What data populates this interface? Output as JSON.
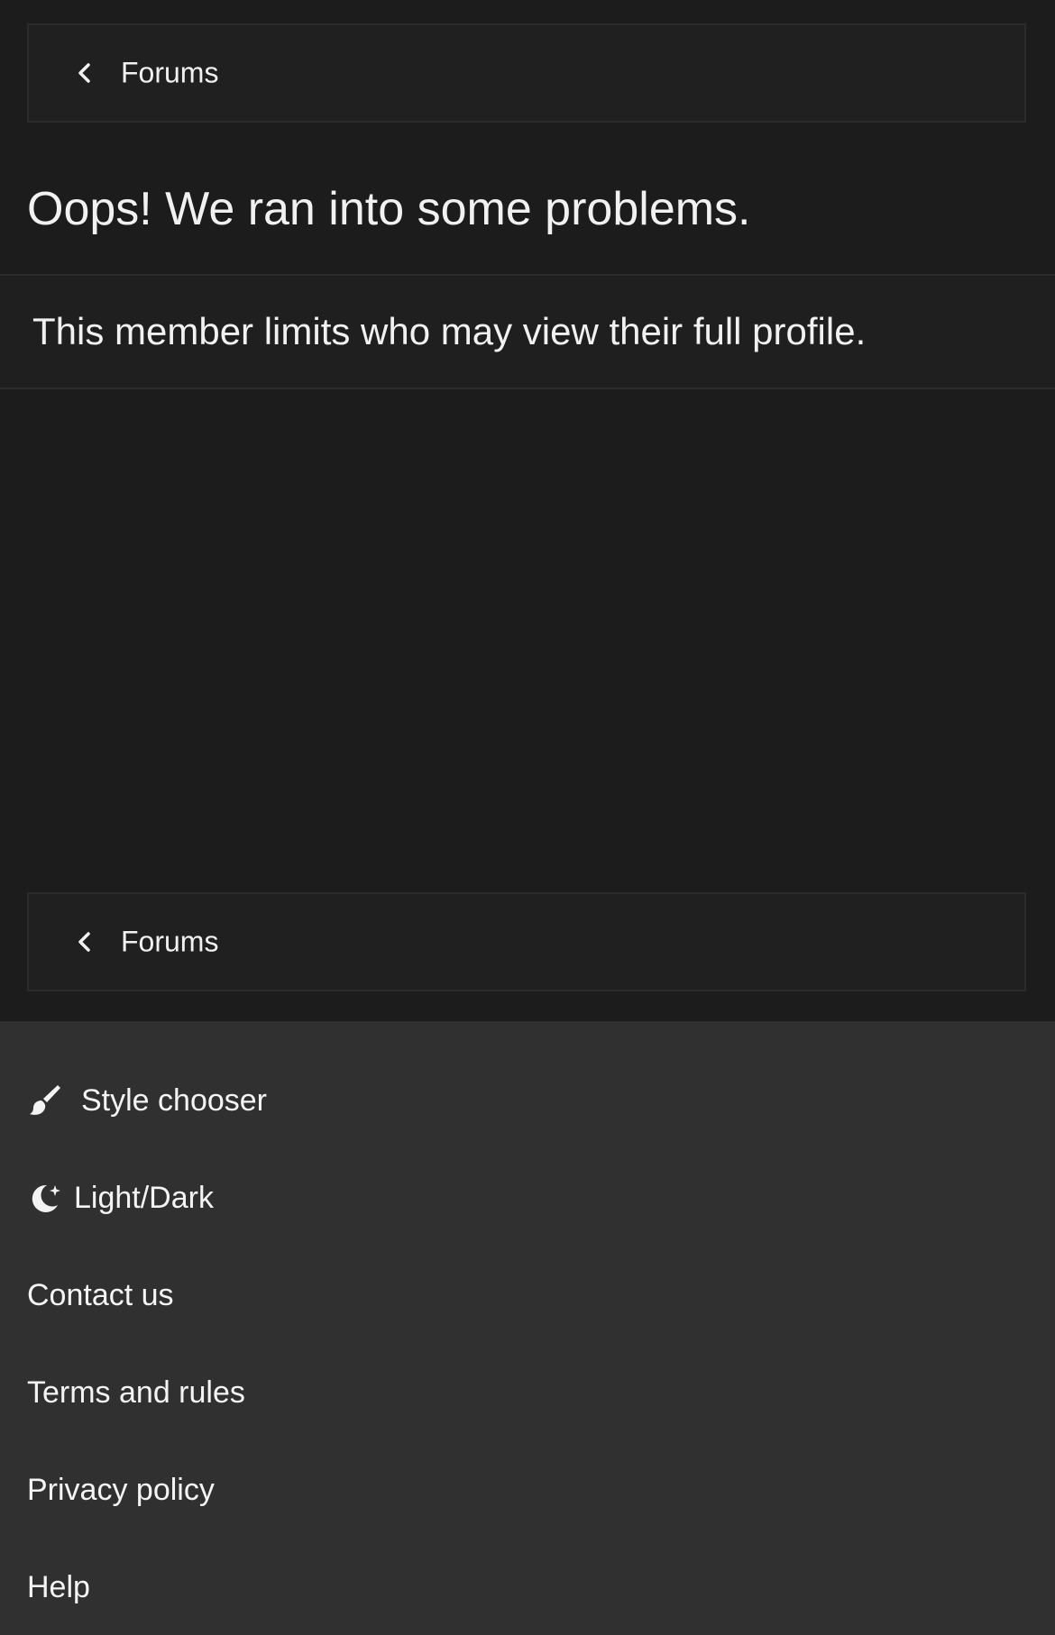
{
  "nav": {
    "back_label_top": "Forums",
    "back_label_bottom": "Forums"
  },
  "error": {
    "title": "Oops! We ran into some problems.",
    "message": "This member limits who may view their full profile."
  },
  "footer": {
    "style_chooser": "Style chooser",
    "light_dark": "Light/Dark",
    "contact_us": "Contact us",
    "terms": "Terms and rules",
    "privacy": "Privacy policy",
    "help": "Help"
  },
  "icons": {
    "back": "chevron-left-icon",
    "style": "paintbrush-icon",
    "theme": "moon-sparkle-icon"
  },
  "colors": {
    "page_bg": "#1c1c1d",
    "footer_bg": "#303031",
    "text": "#f1f1f1"
  }
}
